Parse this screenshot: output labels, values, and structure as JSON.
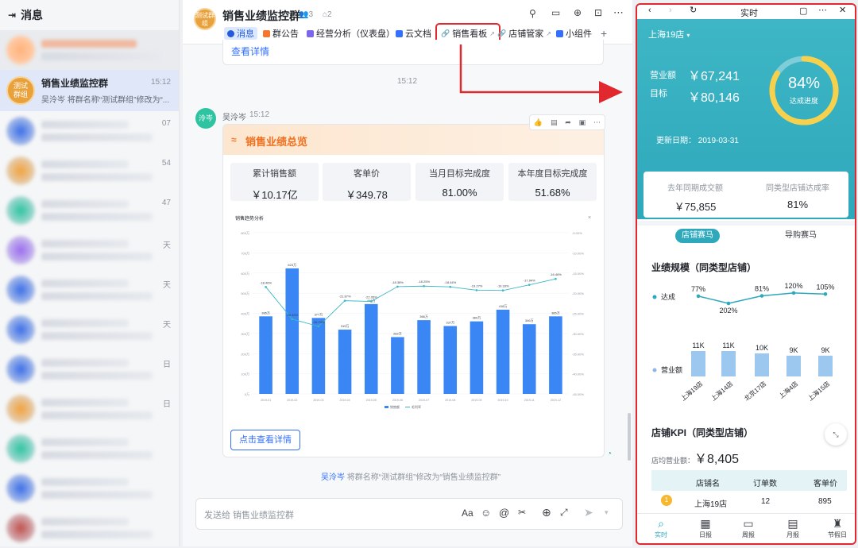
{
  "left": {
    "title": "消息",
    "selected": {
      "name": "销售业绩监控群",
      "time": "15:12",
      "preview": "吴泠岑 将群名称“测试群组”修改为“...",
      "avatar_text": "测试群组"
    },
    "times": [
      "07",
      "54",
      "47",
      "天",
      "天",
      "天",
      "日",
      "日"
    ]
  },
  "chat": {
    "avatar_text": "测试群组",
    "title": "销售业绩监控群",
    "members": "3",
    "bots": "2",
    "tabs": [
      "消息",
      "群公告",
      "经营分析（仪表盘）",
      "云文档",
      "销售看板",
      "店铺管家",
      "小组件"
    ],
    "prev_link": "查看详情",
    "time_divider": "15:12",
    "sender": "吴泠岑",
    "sender_avatar": "泠岑",
    "send_time": "15:12",
    "card_title": "销售业绩总览",
    "kpis": [
      {
        "label": "累计销售额",
        "value": "￥10.17亿"
      },
      {
        "label": "客单价",
        "value": "￥349.78"
      },
      {
        "label": "当月目标完成度",
        "value": "81.00%"
      },
      {
        "label": "本年度目标完成度",
        "value": "51.68%"
      }
    ],
    "detail_button": "点击查看详情",
    "system_msg_user": "吴泠岑",
    "system_msg": " 将群名称“测试群组”修改为“销售业绩监控群”",
    "input_placeholder": "发送给 销售业绩监控群"
  },
  "chart_data": {
    "type": "bar",
    "title": "销售趋势分析",
    "categories": [
      "2019-01",
      "2019-02",
      "2019-03",
      "2019-04",
      "2019-05",
      "2019-06",
      "2019-07",
      "2019-08",
      "2019-09",
      "2019-10",
      "2019-11",
      "2019-12"
    ],
    "series": [
      {
        "name": "销售额",
        "values": [
          385,
          623,
          377,
          319,
          446,
          282,
          366,
          337,
          360,
          418,
          346,
          385
        ]
      },
      {
        "name": "毛利率",
        "values": [
          -18.46,
          -26.45,
          -28.23,
          -21.87,
          -22.05,
          -18.38,
          -18.25,
          -18.44,
          -19.27,
          -19.33,
          -17.94,
          -16.46
        ]
      }
    ],
    "bar_labels": [
      "385万",
      "623万",
      "377万",
      "319万",
      "446万",
      "282万",
      "366万",
      "337万",
      "360万",
      "418万",
      "346万",
      "385万"
    ],
    "line_labels": [
      "-18.46%",
      "-26.45%",
      "-28.23%",
      "-21.87%",
      "-22.05%",
      "-18.38%",
      "-18.25%",
      "-18.44%",
      "-19.27%",
      "-19.33%",
      "-17.94%",
      "-16.46%"
    ],
    "y_left_ticks": [
      "800万",
      "700万",
      "600万",
      "500万",
      "400万",
      "300万",
      "200万",
      "100万",
      "0万"
    ],
    "y_right_ticks": [
      "-5.00%",
      "-10.00%",
      "-15.00%",
      "-20.00%",
      "-25.00%",
      "-30.00%",
      "-35.00%",
      "-40.00%",
      "-45.00%"
    ],
    "ylim": [
      0,
      800
    ],
    "y2lim": [
      -45,
      -5
    ],
    "legend": [
      "销售额",
      "毛利率"
    ],
    "colors": {
      "bar": "#3a86f5",
      "line": "#3ab8c4"
    }
  },
  "right": {
    "nav_title": "实时",
    "store": "上海19店",
    "revenue_label": "营业额",
    "revenue": "￥67,241",
    "target_label": "目标",
    "target": "￥80,146",
    "progress_pct": "84%",
    "progress_value": 0.84,
    "progress_label": "达成进度",
    "update_label": "更新日期：",
    "update_date": "2019-03-31",
    "compare": [
      {
        "label": "去年同期成交额",
        "value": "￥75,855"
      },
      {
        "label": "同类型店铺达成率",
        "value": "81%"
      }
    ],
    "race_tabs": [
      "店铺赛马",
      "导购赛马"
    ],
    "scale_title": "业绩规模（同类型店铺）",
    "reach_label": "达成",
    "reach_values": [
      "77%",
      "202%",
      "81%",
      "120%",
      "105%"
    ],
    "revenue_series_label": "营业额",
    "bar_values": [
      "11K",
      "11K",
      "10K",
      "9K",
      "9K"
    ],
    "stores": [
      "上海19店",
      "上海14店",
      "北京17店",
      "上海4店",
      "上海15店"
    ],
    "kpi_title": "店铺KPI（同类型店铺）",
    "avg_label": "店均营业额：",
    "avg_value": "￥8,405",
    "table_headers": [
      "店铺名",
      "订单数",
      "客单价"
    ],
    "table_row": [
      "上海19店",
      "12",
      "895"
    ],
    "bottom_tabs": [
      "实时",
      "日报",
      "周报",
      "月报",
      "节假日"
    ]
  }
}
